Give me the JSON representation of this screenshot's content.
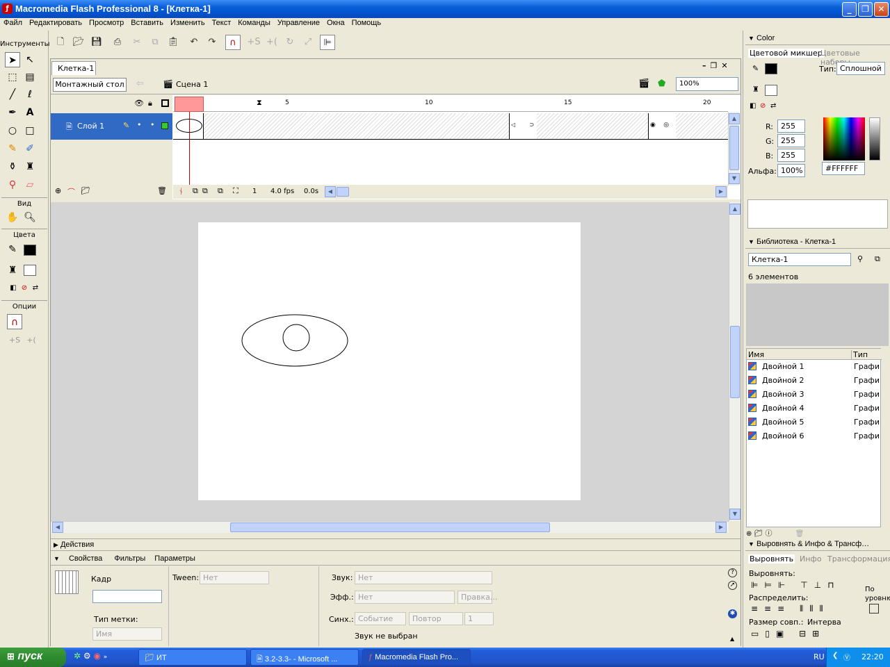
{
  "window": {
    "title": "Macromedia Flash Professional 8 - [Клетка-1]",
    "minimize": "_",
    "restore": "❐",
    "close": "✕"
  },
  "menu": [
    "Файл",
    "Редактировать",
    "Просмотр",
    "Вставить",
    "Изменить",
    "Текст",
    "Команды",
    "Управление",
    "Окна",
    "Помощь"
  ],
  "tools": {
    "title": "Инструменты",
    "view_label": "Вид",
    "colors_label": "Цвета",
    "options_label": "Опции"
  },
  "document": {
    "tab": "Клетка-1",
    "timeline_button": "Монтажный стол",
    "scene": "Сцена 1",
    "zoom": "100%"
  },
  "timeline": {
    "layer_name": "Слой 1",
    "ruler_numbers": [
      "5",
      "10",
      "15",
      "20"
    ],
    "current_frame": "1",
    "frame_rate": "4.0 fps",
    "elapsed": "0.0s"
  },
  "color_panel": {
    "header": "Color",
    "tab_mixer": "Цветовой микшер",
    "tab_swatches": "Цветовые наборы",
    "type_label": "Тип:",
    "type_value": "Сплошной",
    "r_label": "R:",
    "r_value": "255",
    "g_label": "G:",
    "g_value": "255",
    "b_label": "B:",
    "b_value": "255",
    "alpha_label": "Альфа:",
    "alpha_value": "100%",
    "hex_value": "#FFFFFF"
  },
  "library_panel": {
    "header": "Библиотека - Клетка-1",
    "selected_doc": "Клетка-1",
    "count": "6 элементов",
    "col_name": "Имя",
    "col_type": "Тип",
    "items": [
      {
        "name": "Двойной 1",
        "type": "Графи"
      },
      {
        "name": "Двойной 2",
        "type": "Графи"
      },
      {
        "name": "Двойной 3",
        "type": "Графи"
      },
      {
        "name": "Двойной 4",
        "type": "Графи"
      },
      {
        "name": "Двойной 5",
        "type": "Графи"
      },
      {
        "name": "Двойной 6",
        "type": "Графи"
      }
    ]
  },
  "align_panel": {
    "header": "Выровнять & Инфо & Трансф…",
    "tab_align": "Выровнять",
    "tab_info": "Инфо",
    "tab_transform": "Трансформация",
    "align_label": "Выровнять:",
    "distribute_label": "Распределить:",
    "match_size_label": "Размер совп.:",
    "spacing_label": "Интерва",
    "to_stage_label": "По уровню"
  },
  "actions_panel": {
    "header": "Действия"
  },
  "properties_panel": {
    "tab_properties": "Свойства",
    "tab_filters": "Фильтры",
    "tab_params": "Параметры",
    "frame_label": "Кадр",
    "tween_label": "Tween:",
    "tween_value": "Нет",
    "sound_label": "Звук:",
    "sound_value": "Нет",
    "effect_label": "Эфф.:",
    "effect_value": "Нет",
    "edit_button": "Правка...",
    "sync_label": "Синх.:",
    "sync_value": "Событие",
    "repeat_value": "Повтор",
    "repeat_count": "1",
    "label_type": "Тип метки:",
    "label_type_value": "Имя",
    "no_sound": "Звук не выбран"
  },
  "taskbar": {
    "start": "пуск",
    "items": [
      "ИТ",
      "3.2-3.3- - Microsoft ...",
      "Macromedia Flash Pro..."
    ],
    "lang": "RU",
    "clock": "22:20"
  }
}
